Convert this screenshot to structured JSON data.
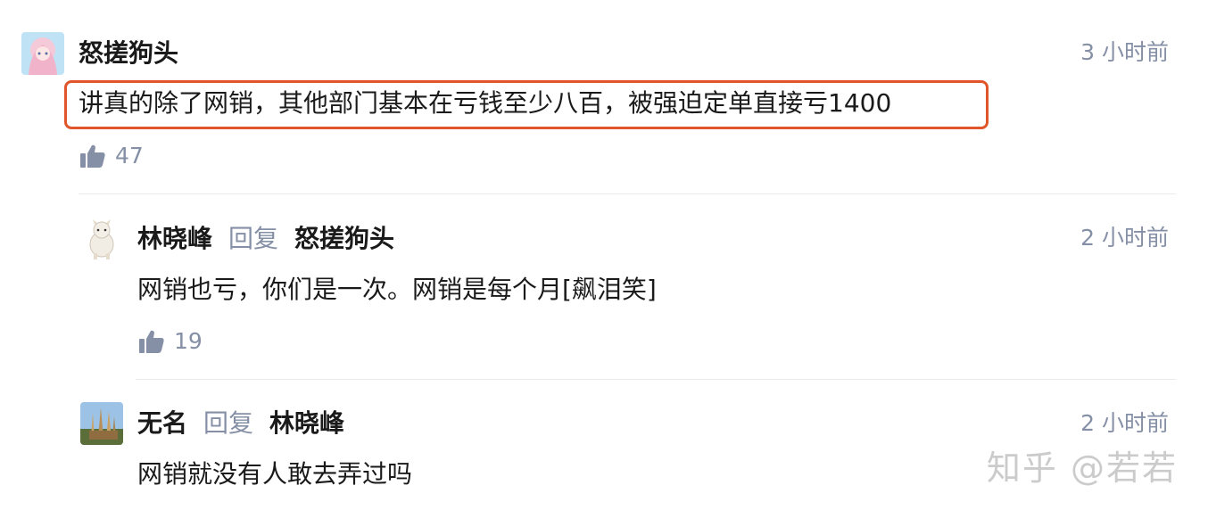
{
  "comments": [
    {
      "author": "怒搓狗头",
      "time": "3 小时前",
      "content": "讲真的除了网销，其他部门基本在亏钱至少八百，被强迫定单直接亏1400",
      "likes": "47"
    },
    {
      "author": "林晓峰",
      "reply_word": "回复",
      "reply_to": "怒搓狗头",
      "time": "2 小时前",
      "content": "网销也亏，你们是一次。网销是每个月[飙泪笑]",
      "likes": "19"
    },
    {
      "author": "无名",
      "reply_word": "回复",
      "reply_to": "林晓峰",
      "time": "2 小时前",
      "content": "网销就没有人敢去弄过吗"
    }
  ],
  "watermark": "知乎 @若若",
  "colors": {
    "highlight_border": "#e0552a",
    "meta_gray": "#8590a6",
    "divider": "#ebebeb"
  },
  "icons": {
    "like": "thumbs-up-icon"
  }
}
